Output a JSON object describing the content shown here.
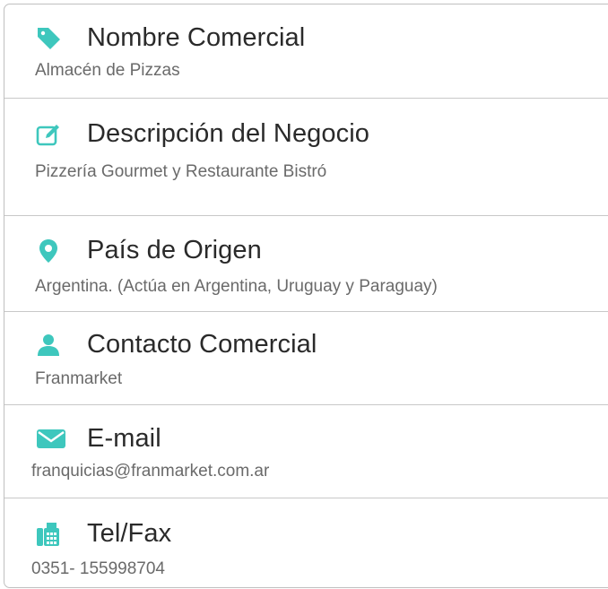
{
  "accent_color": "#3ec7bd",
  "fields": [
    {
      "icon": "tag-icon",
      "title": "Nombre Comercial",
      "value": "Almacén de Pizzas"
    },
    {
      "icon": "edit-icon",
      "title": "Descripción del Negocio",
      "value": "Pizzería Gourmet y Restaurante Bistró"
    },
    {
      "icon": "location-pin-icon",
      "title": "País de Origen",
      "value": "Argentina. (Actúa en Argentina, Uruguay y Paraguay)"
    },
    {
      "icon": "user-icon",
      "title": "Contacto Comercial",
      "value": "Franmarket"
    },
    {
      "icon": "envelope-icon",
      "title": "E-mail",
      "value": "franquicias@franmarket.com.ar"
    },
    {
      "icon": "fax-icon",
      "title": "Tel/Fax",
      "value": "0351- 155998704"
    }
  ]
}
